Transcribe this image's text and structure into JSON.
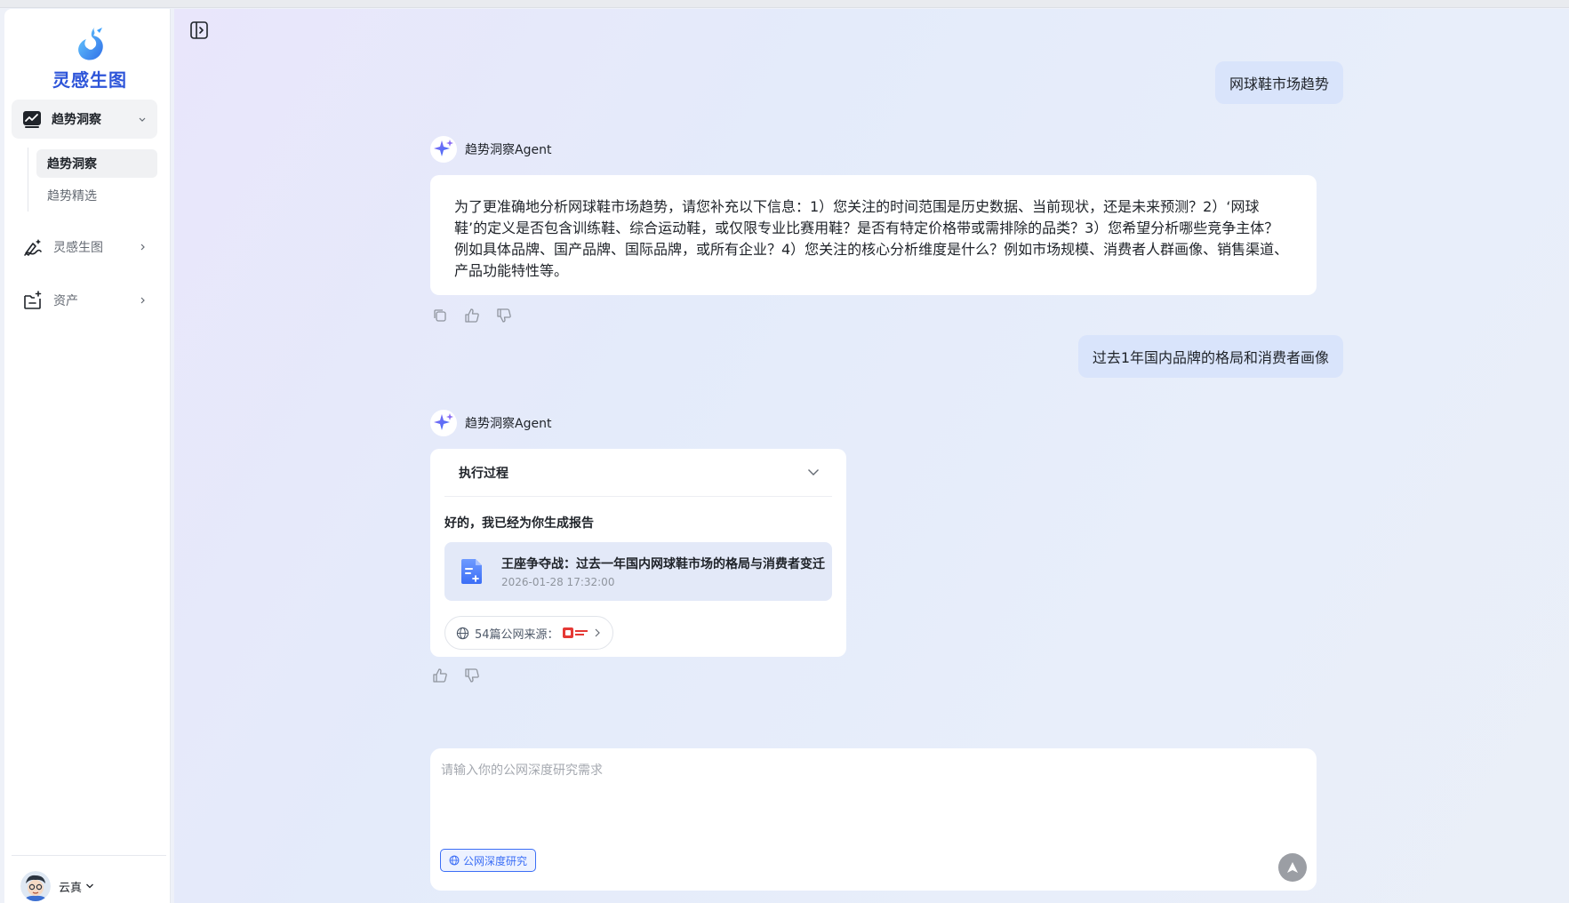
{
  "app": {
    "logo_text": "灵感生图"
  },
  "sidebar": {
    "group": {
      "label": "趋势洞察",
      "icon": "trend-chart-icon"
    },
    "subitems": [
      {
        "label": "趋势洞察",
        "active": true
      },
      {
        "label": "趋势精选",
        "active": false
      }
    ],
    "items": [
      {
        "label": "灵感生图",
        "icon": "magic-pen-icon"
      },
      {
        "label": "资产",
        "icon": "folder-asset-icon"
      }
    ],
    "user": {
      "name": "云真"
    }
  },
  "chat": {
    "messages": [
      {
        "role": "user",
        "text": "网球鞋市场趋势"
      },
      {
        "role": "agent",
        "agent_name": "趋势洞察Agent",
        "text": "为了更准确地分析网球鞋市场趋势，请您补充以下信息：1）您关注的时间范围是历史数据、当前现状，还是未来预测？2）‘网球鞋’的定义是否包含训练鞋、综合运动鞋，或仅限专业比赛用鞋？是否有特定价格带或需排除的品类？3）您希望分析哪些竞争主体？例如具体品牌、国产品牌、国际品牌，或所有企业？4）您关注的核心分析维度是什么？例如市场规模、消费者人群画像、销售渠道、产品功能特性等。"
      },
      {
        "role": "user",
        "text": "过去1年国内品牌的格局和消费者画像"
      },
      {
        "role": "agent",
        "agent_name": "趋势洞察Agent",
        "process_label": "执行过程",
        "done_text": "好的，我已经为你生成报告",
        "report": {
          "title": "王座争夺战：过去一年国内网球鞋市场的格局与消费者变迁",
          "date": "2026-01-28 17:32:00"
        },
        "sources_label": "54篇公网来源："
      }
    ]
  },
  "composer": {
    "placeholder": "请输入你的公网深度研究需求",
    "mode_label": "公网深度研究"
  },
  "colors": {
    "accent": "#3b6ef6",
    "user_bubble": "#d9e4fb",
    "logo": "#2e55d9"
  }
}
